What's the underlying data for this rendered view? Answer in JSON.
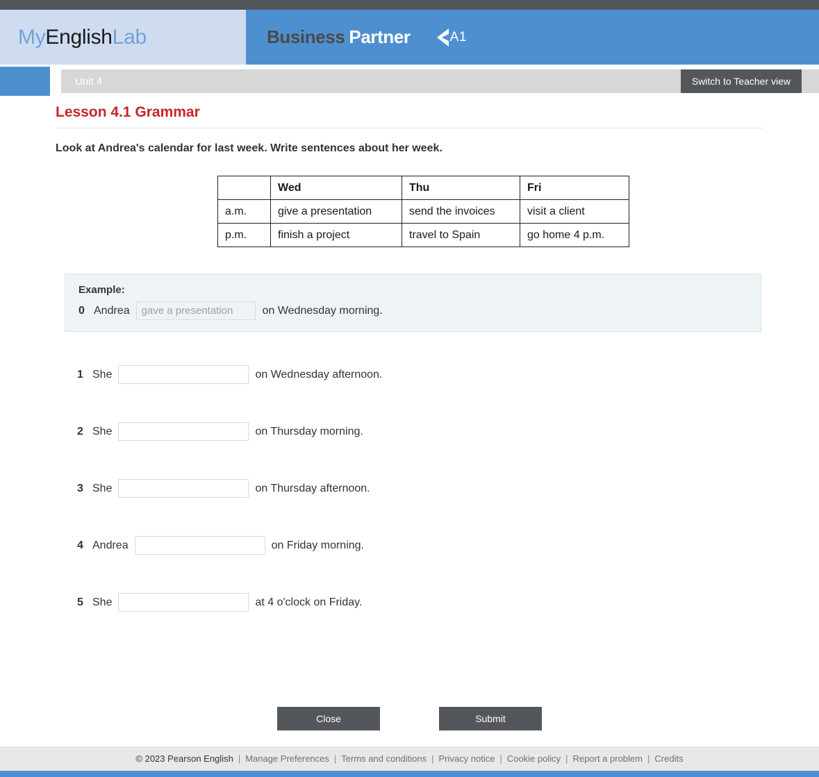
{
  "header": {
    "logo": {
      "my": "My",
      "english": "English",
      "lab": "Lab"
    },
    "product": {
      "business": "Business",
      "partner": "Partner",
      "level": "A1"
    }
  },
  "toolbar": {
    "unit_label": "Unit 4",
    "teacher_view_label": "Switch to Teacher view"
  },
  "lesson": {
    "title": "Lesson 4.1 Grammar",
    "instruction": "Look at Andrea's calendar for last week. Write sentences about her week."
  },
  "calendar": {
    "columns": [
      "",
      "Wed",
      "Thu",
      "Fri"
    ],
    "rows": [
      {
        "label": "a.m.",
        "cells": [
          "give a presentation",
          "send the invoices",
          "visit a client"
        ]
      },
      {
        "label": "p.m.",
        "cells": [
          "finish a project",
          "travel to Spain",
          "go home 4 p.m."
        ]
      }
    ]
  },
  "example": {
    "label": "Example:",
    "number": "0",
    "lead": "Andrea",
    "answer": "gave a presentation",
    "tail": "on Wednesday morning."
  },
  "questions": [
    {
      "number": "1",
      "lead": "She",
      "value": "",
      "tail": "on Wednesday afternoon."
    },
    {
      "number": "2",
      "lead": "She",
      "value": "",
      "tail": "on Thursday morning."
    },
    {
      "number": "3",
      "lead": "She",
      "value": "",
      "tail": "on Thursday afternoon."
    },
    {
      "number": "4",
      "lead": "Andrea",
      "value": "",
      "tail": "on Friday morning."
    },
    {
      "number": "5",
      "lead": "She",
      "value": "",
      "tail": "at 4 o'clock on Friday."
    }
  ],
  "actions": {
    "close_label": "Close",
    "submit_label": "Submit"
  },
  "footer": {
    "copyright": "© 2023 Pearson English",
    "separator": "|",
    "links": [
      "Manage Preferences",
      "Terms and conditions",
      "Privacy notice",
      "Cookie policy",
      "Report a problem",
      "Credits"
    ]
  },
  "colors": {
    "brand_blue": "#4e90cf",
    "logo_bg": "#cfdcf0",
    "dark_gray": "#53565a",
    "accent_red": "#c8242b",
    "example_bg": "#eef3f6"
  }
}
